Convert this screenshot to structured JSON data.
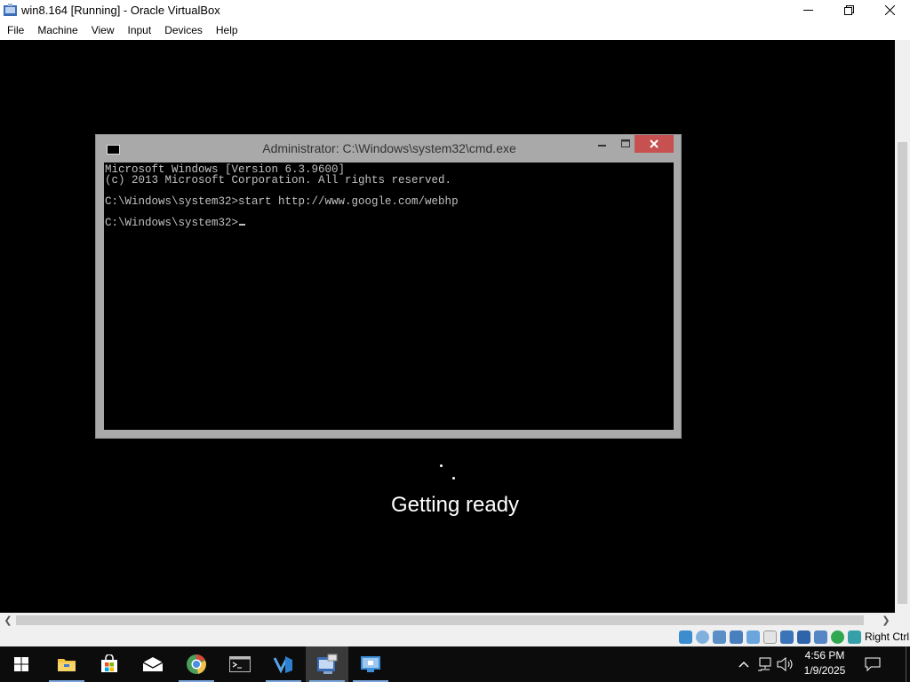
{
  "vbox": {
    "title": "win8.164 [Running] - Oracle VirtualBox",
    "menu": [
      "File",
      "Machine",
      "View",
      "Input",
      "Devices",
      "Help"
    ],
    "host_key": "Right Ctrl",
    "window_controls": {
      "minimize": "minimize-icon",
      "maximize": "restore-icon",
      "close": "close-icon"
    }
  },
  "cmd": {
    "title": "Administrator: C:\\Windows\\system32\\cmd.exe",
    "lines": [
      "Microsoft Windows [Version 6.3.9600]",
      "(c) 2013 Microsoft Corporation. All rights reserved.",
      "",
      "C:\\Windows\\system32>start http://www.google.com/webhp",
      "",
      "C:\\Windows\\system32>"
    ]
  },
  "guest": {
    "status": "Getting ready"
  },
  "taskbar": {
    "apps": [
      "windows-start-icon",
      "file-explorer-icon",
      "store-icon",
      "mail-icon",
      "chrome-icon",
      "terminal-icon",
      "visual-studio-icon",
      "virtualbox-icon",
      "remote-desktop-icon"
    ],
    "active_app": "virtualbox-icon",
    "time": "4:56 PM",
    "date": "1/9/2025"
  },
  "colors": {
    "guest_bg": "#000000",
    "cmd_close": "#c75050",
    "taskbar_bg": "#0c0c0c",
    "active_underline": "#7aa6d9"
  }
}
